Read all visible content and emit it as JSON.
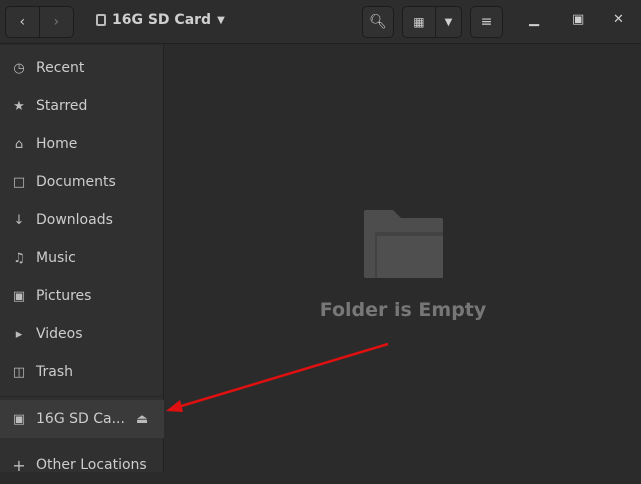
{
  "header": {
    "location": "16G SD Card"
  },
  "sidebar": {
    "items": [
      {
        "label": "Recent",
        "icon": "clock-icon"
      },
      {
        "label": "Starred",
        "icon": "star-icon"
      },
      {
        "label": "Home",
        "icon": "home-icon"
      },
      {
        "label": "Documents",
        "icon": "document-icon"
      },
      {
        "label": "Downloads",
        "icon": "download-icon"
      },
      {
        "label": "Music",
        "icon": "music-icon"
      },
      {
        "label": "Pictures",
        "icon": "camera-icon"
      },
      {
        "label": "Videos",
        "icon": "video-icon"
      },
      {
        "label": "Trash",
        "icon": "trash-icon"
      }
    ],
    "device": {
      "label": "16G SD Ca...",
      "icon": "sd-card-icon"
    },
    "other": {
      "label": "Other Locations"
    }
  },
  "main": {
    "empty_text": "Folder is Empty"
  },
  "annotation": {
    "arrow_color": "#e01010"
  }
}
